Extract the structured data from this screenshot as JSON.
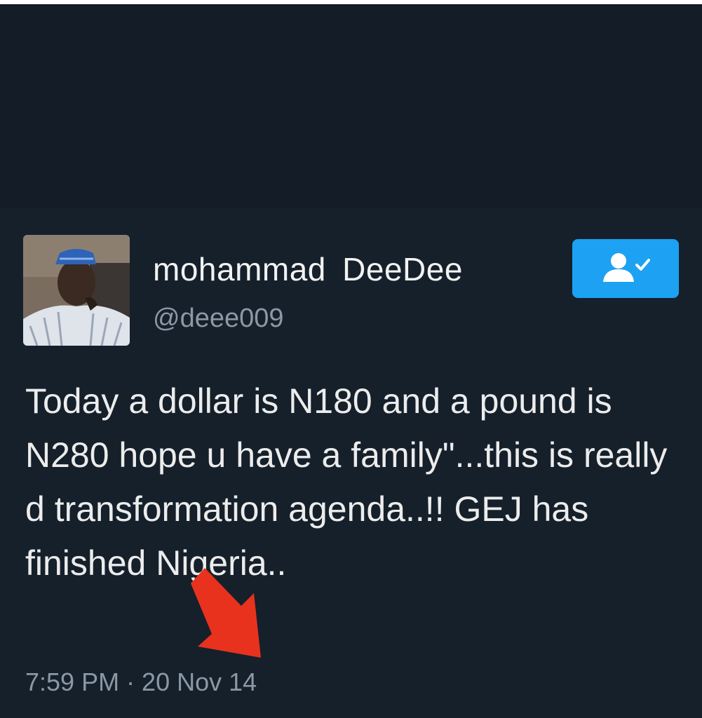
{
  "tweet": {
    "author": {
      "display_name": "mohammad  DeeDee",
      "handle": "@deee009"
    },
    "follow_button": {
      "icon": "follow-user-check-icon",
      "accent_color": "#1da1f2"
    },
    "text": "Today a dollar is N180 and a pound is N280 hope u have a family\"...this is really d transformation agenda..!! GEJ has finished Nigeria..",
    "timestamp": "7:59 PM · 20 Nov 14"
  },
  "annotation": {
    "icon": "red-arrow-icon",
    "color": "#e8321e"
  },
  "colors": {
    "background": "#15202b",
    "secondary_text": "#8b98a5"
  }
}
